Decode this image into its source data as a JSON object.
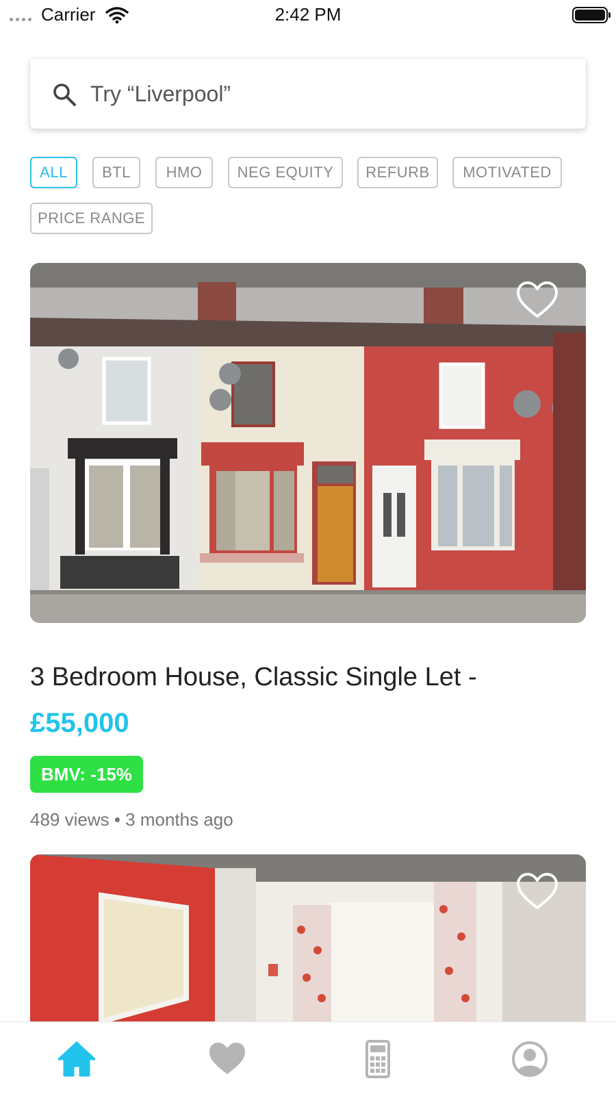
{
  "status_bar": {
    "carrier": "Carrier",
    "time": "2:42 PM"
  },
  "search": {
    "placeholder": "Try “Liverpool”",
    "icon": "search-icon"
  },
  "filters": [
    {
      "label": "ALL",
      "active": true
    },
    {
      "label": "BTL",
      "active": false
    },
    {
      "label": "HMO",
      "active": false
    },
    {
      "label": "NEG EQUITY",
      "active": false
    },
    {
      "label": "REFURB",
      "active": false
    },
    {
      "label": "MOTIVATED",
      "active": false
    },
    {
      "label": "PRICE RANGE",
      "active": false
    }
  ],
  "listings": [
    {
      "title": "3 Bedroom House, Classic Single Let -",
      "price": "£55,000",
      "bmv": "BMV: -15%",
      "meta": "489 views • 3 months ago",
      "favorite_icon": "heart-outline-icon"
    },
    {
      "favorite_icon": "heart-outline-icon"
    }
  ],
  "bottom_nav": [
    {
      "icon": "home-icon",
      "active": true
    },
    {
      "icon": "heart-icon",
      "active": false
    },
    {
      "icon": "calculator-icon",
      "active": false
    },
    {
      "icon": "profile-icon",
      "active": false
    }
  ],
  "colors": {
    "accent": "#22c3ea",
    "bmv_badge": "#2ee044",
    "chip_border": "#c8c8c8",
    "nav_inactive": "#b5b5b5"
  }
}
